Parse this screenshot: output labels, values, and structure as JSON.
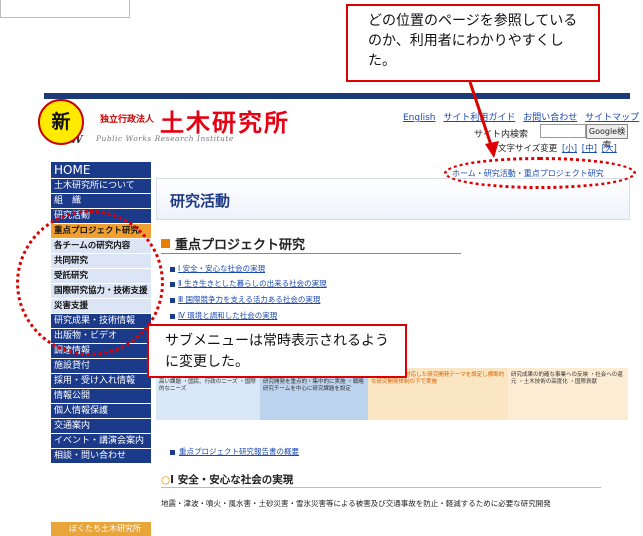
{
  "header": {
    "org_small": "独立行政法人",
    "org_name": "土木研究所",
    "logo_pw": "PW",
    "logo_en": "Public Works Research Institute",
    "links": [
      "English",
      "サイト利用ガイド",
      "お問い合わせ",
      "サイトマップ"
    ],
    "search_label": "サイト内検索",
    "search_button": "Google検索",
    "fontsize_label": "文字サイズ変更",
    "fontsize_options": [
      "[小]",
      "[中]",
      "[大]"
    ]
  },
  "breadcrumb": "ホーム・研究活動・重点プロジェクト研究",
  "sidebar": {
    "items": [
      {
        "label": "HOME",
        "type": "home"
      },
      {
        "label": "土木研究所について",
        "type": "main"
      },
      {
        "label": "組　織",
        "type": "main"
      },
      {
        "label": "研究活動",
        "type": "main"
      },
      {
        "label": "重点プロジェクト研究",
        "type": "sub-active"
      },
      {
        "label": "各チームの研究内容",
        "type": "sub"
      },
      {
        "label": "共同研究",
        "type": "sub"
      },
      {
        "label": "受託研究",
        "type": "sub"
      },
      {
        "label": "国際研究協力・技術支援",
        "type": "sub"
      },
      {
        "label": "災害支援",
        "type": "sub"
      },
      {
        "label": "研究成果・技術情報",
        "type": "main"
      },
      {
        "label": "出版物・ビデオ",
        "type": "main"
      },
      {
        "label": "調達情報",
        "type": "main"
      },
      {
        "label": "施設貸付",
        "type": "main"
      },
      {
        "label": "採用・受け入れ情報",
        "type": "main"
      },
      {
        "label": "情報公開",
        "type": "main"
      },
      {
        "label": "個人情報保護",
        "type": "main"
      },
      {
        "label": "交通案内",
        "type": "main"
      },
      {
        "label": "イベント・講演会案内",
        "type": "main"
      },
      {
        "label": "相談・問い合わせ",
        "type": "main"
      }
    ],
    "banner": "ぼくたち土木研究所"
  },
  "main": {
    "title": "研究活動",
    "pp_heading": "重点プロジェクト研究",
    "pp_links": [
      "Ⅰ 安全・安心な社会の実現",
      "Ⅱ 生き生きとした暮らしの出来る社会の実現",
      "Ⅲ 国際競争力を支える活力ある社会の実現",
      "Ⅳ 環境と調和した社会の実現"
    ],
    "diagram": [
      "・科学技術基本計画等 社会的に要請の高い課題 ・国民、行政のニーズ ・国際的なニーズ",
      "中期目標で示されたⅠ〜Ⅳの目標に対する研究開発を重点的・集中的に実施 ・戦略研究チームを中心に研究課題を設定",
      "Ⅰ〜Ⅳの目標に対応した研究開発テーマを設定し横断的な研究開発体制の下で実施",
      "研究成果の的確な事業への反映 ・社会への還元 ・土木技術の高度化 ・国際貢献"
    ],
    "report_link": "重点プロジェクト研究報告書の概要",
    "section1_heading": "Ⅰ 安全・安心な社会の実現",
    "section1_bullet": "○",
    "section1_body": "地震・津波・噴火・風水害・土砂災害・雪氷災害等による被害及び交通事故を防止・軽減するために必要な研究開発"
  },
  "annotations": {
    "new_badge": "新",
    "callout_top": "どの位置のページを参照しているのか、利用者にわかりやすくした。",
    "callout_bottom": "サブメニューは常時表示されるように変更した。"
  },
  "colors": {
    "nav_main": "#1c3a8a",
    "nav_sub": "#dbe5f5",
    "nav_active": "#f0a030",
    "accent_red": "#dd0000",
    "badge_yellow": "#ffea00"
  }
}
